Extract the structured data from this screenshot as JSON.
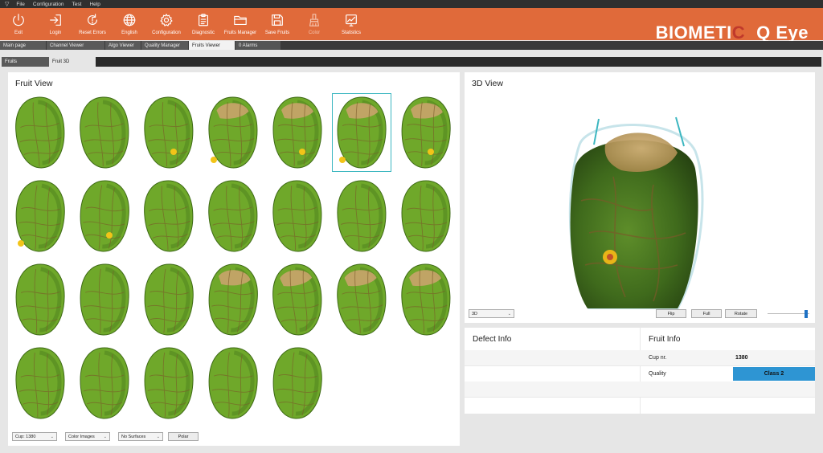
{
  "menubar": {
    "app_icon": "triangle-down-icon",
    "items": [
      "File",
      "Configuration",
      "Test",
      "Help"
    ]
  },
  "toolbar": {
    "buttons": [
      {
        "label": "Exit",
        "icon": "power-icon",
        "enabled": true
      },
      {
        "label": "Login",
        "icon": "login-icon",
        "enabled": true
      },
      {
        "label": "Reset Errors",
        "icon": "reset-icon",
        "enabled": true
      },
      {
        "label": "English",
        "icon": "globe-icon",
        "enabled": true
      },
      {
        "label": "Configuration",
        "icon": "gear-icon",
        "enabled": true
      },
      {
        "label": "Diagnostic",
        "icon": "clipboard-icon",
        "enabled": true
      },
      {
        "label": "Fruits Manager",
        "icon": "folder-icon",
        "enabled": true
      },
      {
        "label": "Save Fruits",
        "icon": "save-icon",
        "enabled": true
      },
      {
        "label": "Color",
        "icon": "brush-icon",
        "enabled": false
      },
      {
        "label": "Statistics",
        "icon": "chart-icon",
        "enabled": true
      }
    ],
    "brand_prefix": "BIOMETI",
    "brand_dot": "C",
    "brand_product": "Q Eye"
  },
  "tabs": [
    {
      "label": "Main page",
      "active": false
    },
    {
      "label": "Channel Viewer",
      "active": false
    },
    {
      "label": "Algo Viewer",
      "active": false
    },
    {
      "label": "Quality Manager",
      "active": false
    },
    {
      "label": "Fruits Viewer",
      "active": true
    },
    {
      "label": "0 Alarms",
      "active": false
    }
  ],
  "subtabs": [
    {
      "label": "Fruits",
      "active": false
    },
    {
      "label": "Fruit 3D",
      "active": true
    }
  ],
  "fruit_view": {
    "title": "Fruit View",
    "selected_index": 5,
    "fruits": [
      {
        "patch": false,
        "flower": false
      },
      {
        "patch": false,
        "flower": false
      },
      {
        "patch": false,
        "flower": true
      },
      {
        "patch": true,
        "flower": true
      },
      {
        "patch": true,
        "flower": true
      },
      {
        "patch": true,
        "flower": true
      },
      {
        "patch": true,
        "flower": true
      },
      {
        "patch": false,
        "flower": true
      },
      {
        "patch": false,
        "flower": true
      },
      {
        "patch": false,
        "flower": false
      },
      {
        "patch": false,
        "flower": false
      },
      {
        "patch": false,
        "flower": false
      },
      {
        "patch": false,
        "flower": false
      },
      {
        "patch": false,
        "flower": false
      },
      {
        "patch": false,
        "flower": false
      },
      {
        "patch": false,
        "flower": false
      },
      {
        "patch": false,
        "flower": false
      },
      {
        "patch": true,
        "flower": false
      },
      {
        "patch": true,
        "flower": false
      },
      {
        "patch": true,
        "flower": false
      },
      {
        "patch": true,
        "flower": false
      },
      {
        "patch": false,
        "flower": false
      },
      {
        "patch": false,
        "flower": false
      },
      {
        "patch": false,
        "flower": false
      },
      {
        "patch": false,
        "flower": false
      },
      {
        "patch": false,
        "flower": false
      }
    ],
    "cup_select": "Cup: 1380",
    "image_select": "Color Images",
    "surface_select": "No Surfaces",
    "polar_button": "Polar"
  },
  "view_3d": {
    "title": "3D View",
    "mode_select": "3D",
    "flip_button": "Flip",
    "full_button": "Full",
    "rotate_button": "Rotate",
    "slider_value": 0.95
  },
  "defect_info": {
    "title": "Defect Info"
  },
  "fruit_info": {
    "title": "Fruit Info",
    "cup_label": "Cup nr.",
    "cup_value": "1380",
    "quality_label": "Quality",
    "quality_value": "Class 2"
  },
  "colors": {
    "toolbar": "#e06a3a",
    "selection": "#3bb6c0",
    "quality_badge": "#2e95d3",
    "fruit_green": "#6fa82a",
    "patch_tan": "#c9a36b",
    "flower_yellow": "#f2c418"
  }
}
